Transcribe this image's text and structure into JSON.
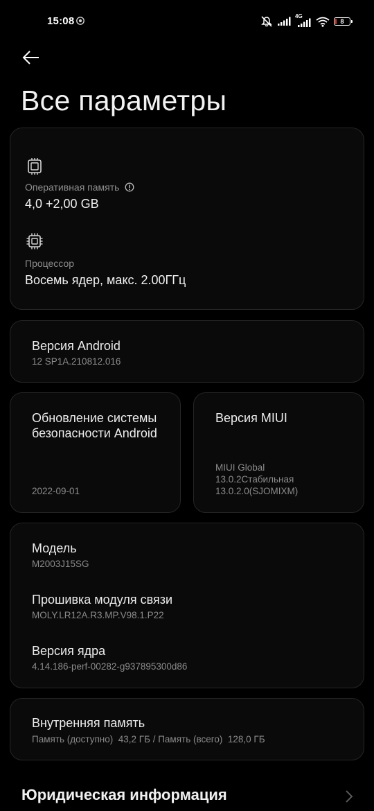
{
  "status_bar": {
    "time": "15:08",
    "network": "4G",
    "battery_level_percent": 8,
    "battery_text": "8",
    "battery_color": "#e0392b",
    "icons": [
      "notification-icon",
      "mute-vibrate-icon",
      "signal-icon",
      "signal-4g-icon",
      "wifi-icon",
      "battery-icon"
    ]
  },
  "header": {
    "back_icon": "arrow-left-icon",
    "title": "Все параметры"
  },
  "hardware": {
    "ram": {
      "icon": "memory-chip-icon",
      "label": "Оперативная память",
      "info_icon": "info-icon",
      "value": "4,0 +2,00 GB"
    },
    "cpu": {
      "icon": "processor-chip-icon",
      "label": "Процессор",
      "value": "Восемь ядер, макс. 2.00ГГц"
    }
  },
  "android_version": {
    "title": "Версия Android",
    "value": "12 SP1A.210812.016"
  },
  "security_update": {
    "title": "Обновление системы безопасности Android",
    "value": "2022-09-01"
  },
  "miui_version": {
    "title": "Версия MIUI",
    "value_lines": [
      "MIUI Global",
      "13.0.2Стабильная",
      "13.0.2.0(SJOMIXM)"
    ]
  },
  "details": [
    {
      "title": "Модель",
      "value": "M2003J15SG"
    },
    {
      "title": "Прошивка модуля связи",
      "value": "MOLY.LR12A.R3.MP.V98.1.P22"
    },
    {
      "title": "Версия ядра",
      "value": "4.14.186-perf-00282-g937895300d86"
    }
  ],
  "storage": {
    "title": "Внутренняя память",
    "value": "Память (доступно)  43,2 ГБ / Память (всего)  128,0 ГБ"
  },
  "legal": {
    "title": "Юридическая информация",
    "chevron_icon": "chevron-right-icon"
  },
  "colors": {
    "background": "#000000",
    "card": "#0a0a0a",
    "card_border": "#262626",
    "secondary_text": "#8d8d8d"
  }
}
